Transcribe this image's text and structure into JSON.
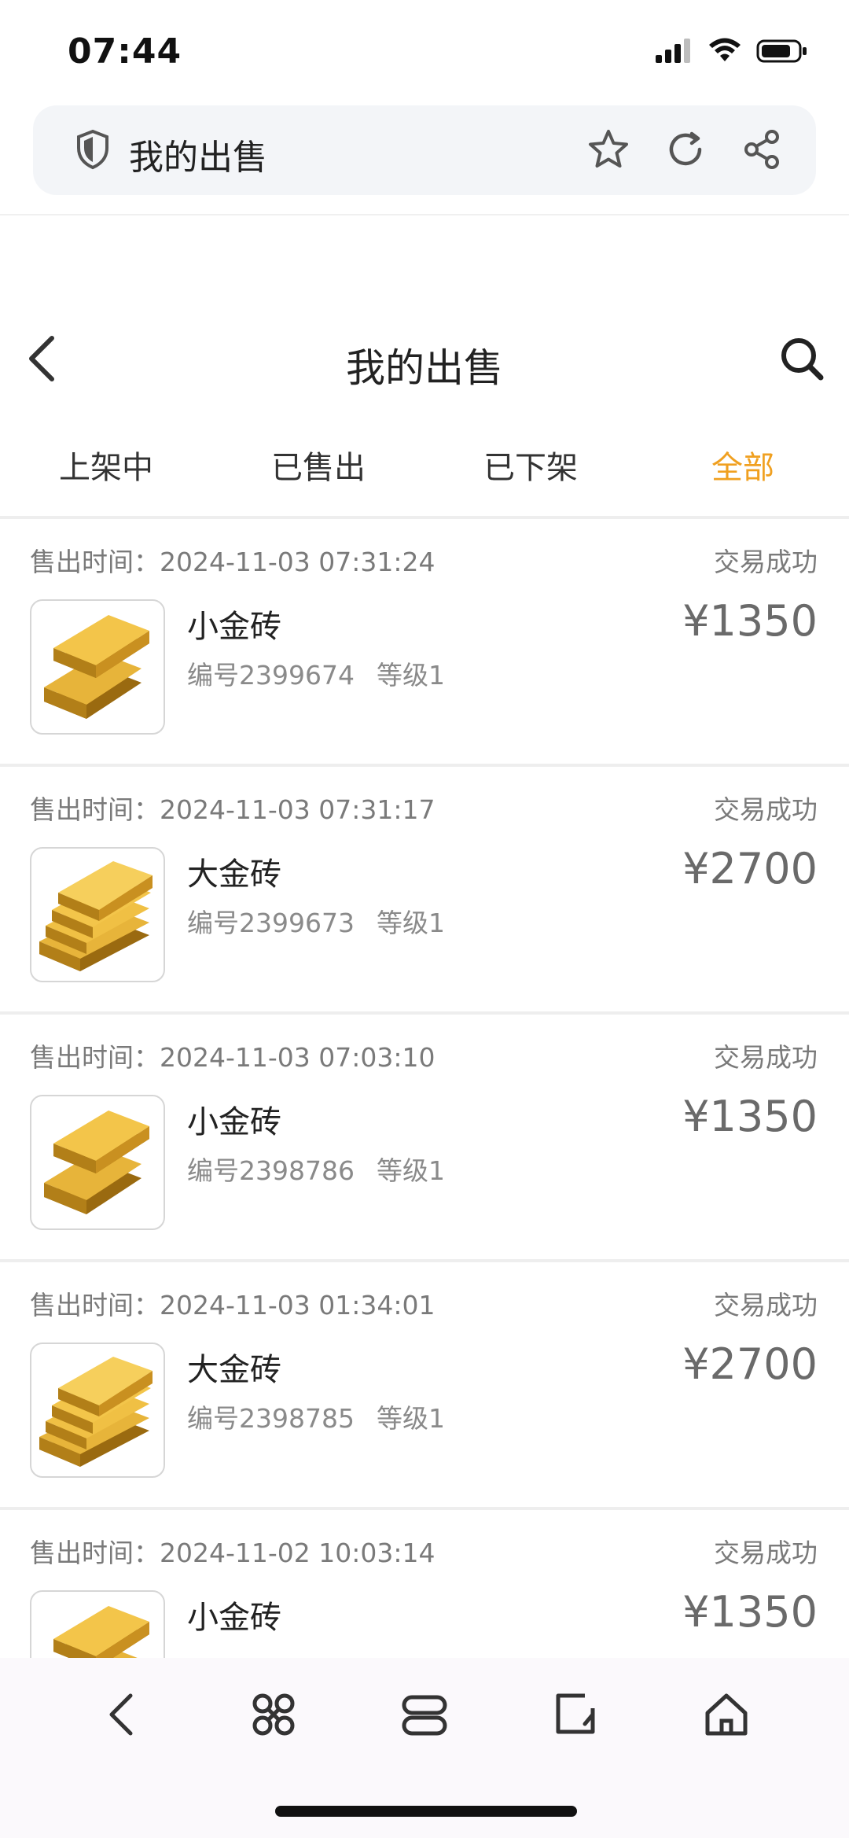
{
  "status_bar": {
    "time": "07:44"
  },
  "browser": {
    "url_title": "我的出售"
  },
  "header": {
    "title": "我的出售"
  },
  "tabs": [
    {
      "label": "上架中",
      "active": false
    },
    {
      "label": "已售出",
      "active": false
    },
    {
      "label": "已下架",
      "active": false
    },
    {
      "label": "全部",
      "active": true
    }
  ],
  "orders": [
    {
      "time": "售出时间：2024-11-03 07:31:24",
      "status": "交易成功",
      "name": "小金砖",
      "id": "编号2399674",
      "level": "等级1",
      "price": "¥1350"
    },
    {
      "time": "售出时间：2024-11-03 07:31:17",
      "status": "交易成功",
      "name": "大金砖",
      "id": "编号2399673",
      "level": "等级1",
      "price": "¥2700"
    },
    {
      "time": "售出时间：2024-11-03 07:03:10",
      "status": "交易成功",
      "name": "小金砖",
      "id": "编号2398786",
      "level": "等级1",
      "price": "¥1350"
    },
    {
      "time": "售出时间：2024-11-03 01:34:01",
      "status": "交易成功",
      "name": "大金砖",
      "id": "编号2398785",
      "level": "等级1",
      "price": "¥2700"
    },
    {
      "time": "售出时间：2024-11-02 10:03:14",
      "status": "交易成功",
      "name": "小金砖",
      "id": "",
      "level": "",
      "price": "¥1350"
    }
  ],
  "colors": {
    "accent": "#f0a020",
    "muted": "#7a7a7a",
    "price": "#6a6a6a"
  },
  "icons": [
    "shield-icon",
    "star-icon",
    "refresh-icon",
    "share-icon",
    "back-icon",
    "search-icon",
    "gold-bar-icon",
    "command-icon",
    "tabs-icon",
    "edit-icon",
    "home-icon"
  ]
}
